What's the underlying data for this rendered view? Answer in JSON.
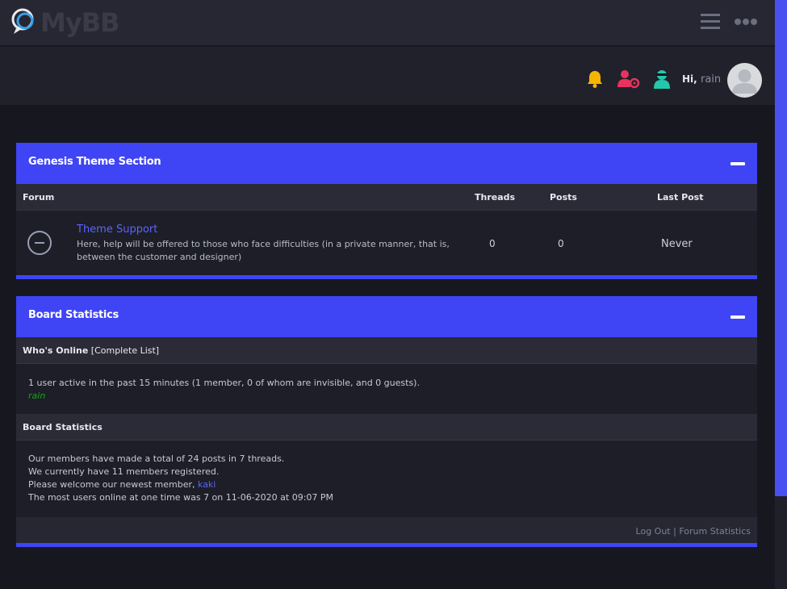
{
  "header": {
    "logo_text": "MyBB",
    "user": {
      "greeting": "Hi,",
      "name": "rain"
    }
  },
  "forum_section": {
    "title": "Genesis Theme Section",
    "columns": [
      "Forum",
      "Threads",
      "Posts",
      "Last Post"
    ],
    "forums": [
      {
        "name": "Theme Support",
        "description": "Here, help will be offered to those who face difficulties (in a private manner, that is, between the customer and designer)",
        "threads": "0",
        "posts": "0",
        "last_post": "Never"
      }
    ]
  },
  "board_stats": {
    "title": "Board Statistics",
    "whos_online": {
      "heading": "Who's Online",
      "complete_list": "[Complete List]",
      "summary": "1 user active in the past 15 minutes (1 member, 0 of whom are invisible, and 0 guests).",
      "members": [
        "rain"
      ]
    },
    "stats": {
      "heading": "Board Statistics",
      "line1": "Our members have made a total of 24 posts in 7 threads.",
      "line2": "We currently have 11 members registered.",
      "line3_prefix": "Please welcome our newest member,",
      "newest_member": "kaki",
      "line4": "The most users online at one time was 7 on 11-06-2020 at 09:07 PM"
    },
    "footer": {
      "logout": "Log Out",
      "separator": "|",
      "forum_stats": "Forum Statistics"
    }
  },
  "colors": {
    "accent": "#3f44f4",
    "link": "#5c63ff",
    "online_member": "#1aa31a",
    "bell": "#f5b400",
    "user_gear": "#e8335e",
    "user_mod": "#23c7ab"
  },
  "icons": [
    "chat-bubble-logo-icon",
    "hamburger-menu-icon",
    "more-dots-icon",
    "bell-icon",
    "user-settings-icon",
    "user-moderator-icon",
    "avatar-icon",
    "forum-status-icon",
    "collapse-icon"
  ]
}
